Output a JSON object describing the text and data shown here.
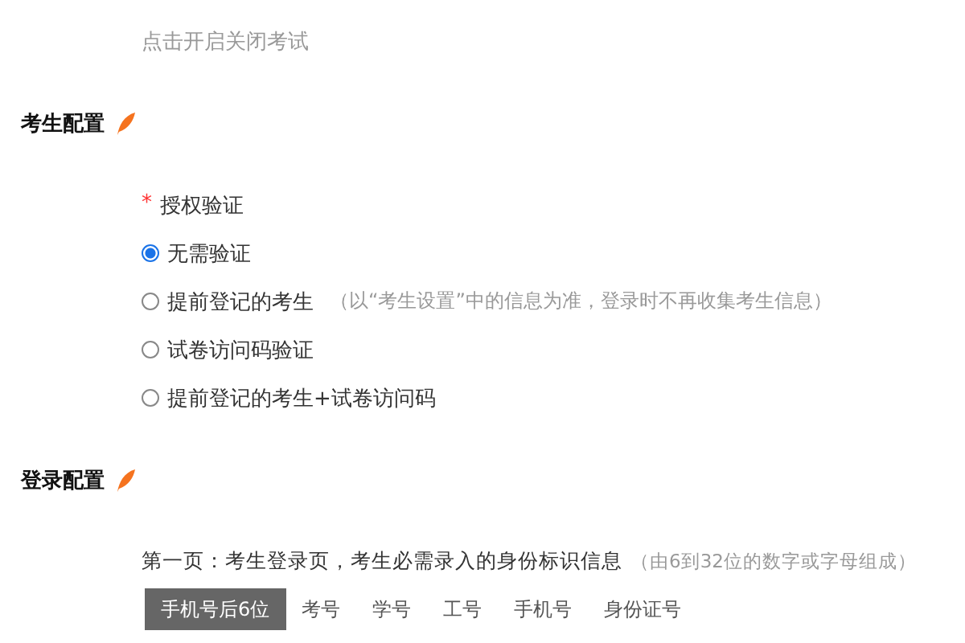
{
  "toggle_hint": "点击开启关闭考试",
  "sections": [
    {
      "title": "考生配置"
    },
    {
      "title": "登录配置"
    }
  ],
  "auth": {
    "label": "授权验证",
    "required_mark": "*",
    "options": [
      {
        "label": "无需验证",
        "selected": true
      },
      {
        "label": "提前登记的考生",
        "note": "（以“考生设置”中的信息为准，登录时不再收集考生信息）",
        "selected": false
      },
      {
        "label": "试卷访问码验证",
        "selected": false
      },
      {
        "label": "提前登记的考生+试卷访问码",
        "selected": false
      }
    ]
  },
  "login": {
    "description": "第一页：考生登录页，考生必需录入的身份标识信息",
    "note": "（由6到32位的数字或字母组成）",
    "fields": [
      {
        "label": "手机号后6位",
        "selected": true
      },
      {
        "label": "考号",
        "selected": false
      },
      {
        "label": "学号",
        "selected": false
      },
      {
        "label": "工号",
        "selected": false
      },
      {
        "label": "手机号",
        "selected": false
      },
      {
        "label": "身份证号",
        "selected": false
      }
    ]
  }
}
